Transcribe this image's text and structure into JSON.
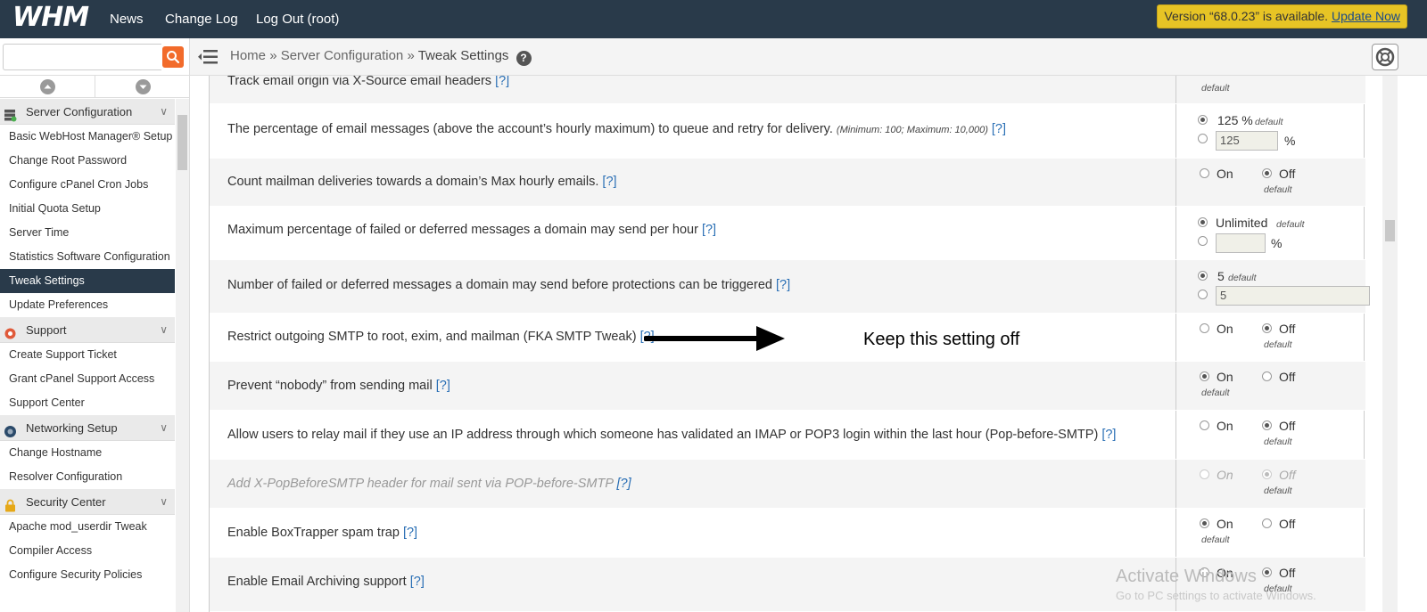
{
  "header": {
    "logo": "WHM",
    "nav": [
      "News",
      "Change Log",
      "Log Out (root)"
    ],
    "version_notice": "Version “68.0.23” is available.",
    "update_link": "Update Now"
  },
  "search": {
    "value": "",
    "placeholder": ""
  },
  "breadcrumb": {
    "home": "Home",
    "section": "Server Configuration",
    "current": "Tweak Settings",
    "sep": "»",
    "help": "?"
  },
  "sidebar": {
    "groups": [
      {
        "category": "Server Configuration",
        "icon": "server-icon",
        "items": [
          "Basic WebHost Manager® Setup",
          "Change Root Password",
          "Configure cPanel Cron Jobs",
          "Initial Quota Setup",
          "Server Time",
          "Statistics Software Configuration",
          "Tweak Settings",
          "Update Preferences"
        ]
      },
      {
        "category": "Support",
        "icon": "lifebuoy-icon",
        "items": [
          "Create Support Ticket",
          "Grant cPanel Support Access",
          "Support Center"
        ]
      },
      {
        "category": "Networking Setup",
        "icon": "globe-icon",
        "items": [
          "Change Hostname",
          "Resolver Configuration"
        ]
      },
      {
        "category": "Security Center",
        "icon": "lock-icon",
        "items": [
          "Apache mod_userdir Tweak",
          "Compiler Access",
          "Configure Security Policies"
        ]
      }
    ],
    "active_item": "Tweak Settings"
  },
  "settings": {
    "help_link": "[?]",
    "default_label": "default",
    "on_label": "On",
    "off_label": "Off",
    "rows": [
      {
        "label": "Track email origin via X-Source email headers"
      },
      {
        "label": "The percentage of email messages (above the account’s hourly maximum) to queue and retry for delivery.",
        "note": "(Minimum: 100; Maximum: 10,000)",
        "default_value": "125 %",
        "input_value": "125",
        "unit": "%"
      },
      {
        "label": "Count mailman deliveries towards a domain’s Max hourly emails."
      },
      {
        "label": "Maximum percentage of failed or deferred messages a domain may send per hour",
        "default_value": "Unlimited",
        "input_value": "",
        "unit": "%"
      },
      {
        "label": "Number of failed or deferred messages a domain may send before protections can be triggered",
        "default_value": "5",
        "input_value": "5"
      },
      {
        "label": "Restrict outgoing SMTP to root, exim, and mailman (FKA SMTP Tweak)"
      },
      {
        "label": "Prevent “nobody” from sending mail"
      },
      {
        "label": "Allow users to relay mail if they use an IP address through which someone has validated an IMAP or POP3 login within the last hour (Pop-before-SMTP)"
      },
      {
        "label": "Add X-PopBeforeSMTP header for mail sent via POP-before-SMTP"
      },
      {
        "label": "Enable BoxTrapper spam trap"
      },
      {
        "label": "Enable Email Archiving support"
      }
    ]
  },
  "annotation": {
    "text": "Keep this setting off"
  },
  "watermark": {
    "line1": "Activate Windows",
    "line2": "Go to PC settings to activate Windows."
  }
}
